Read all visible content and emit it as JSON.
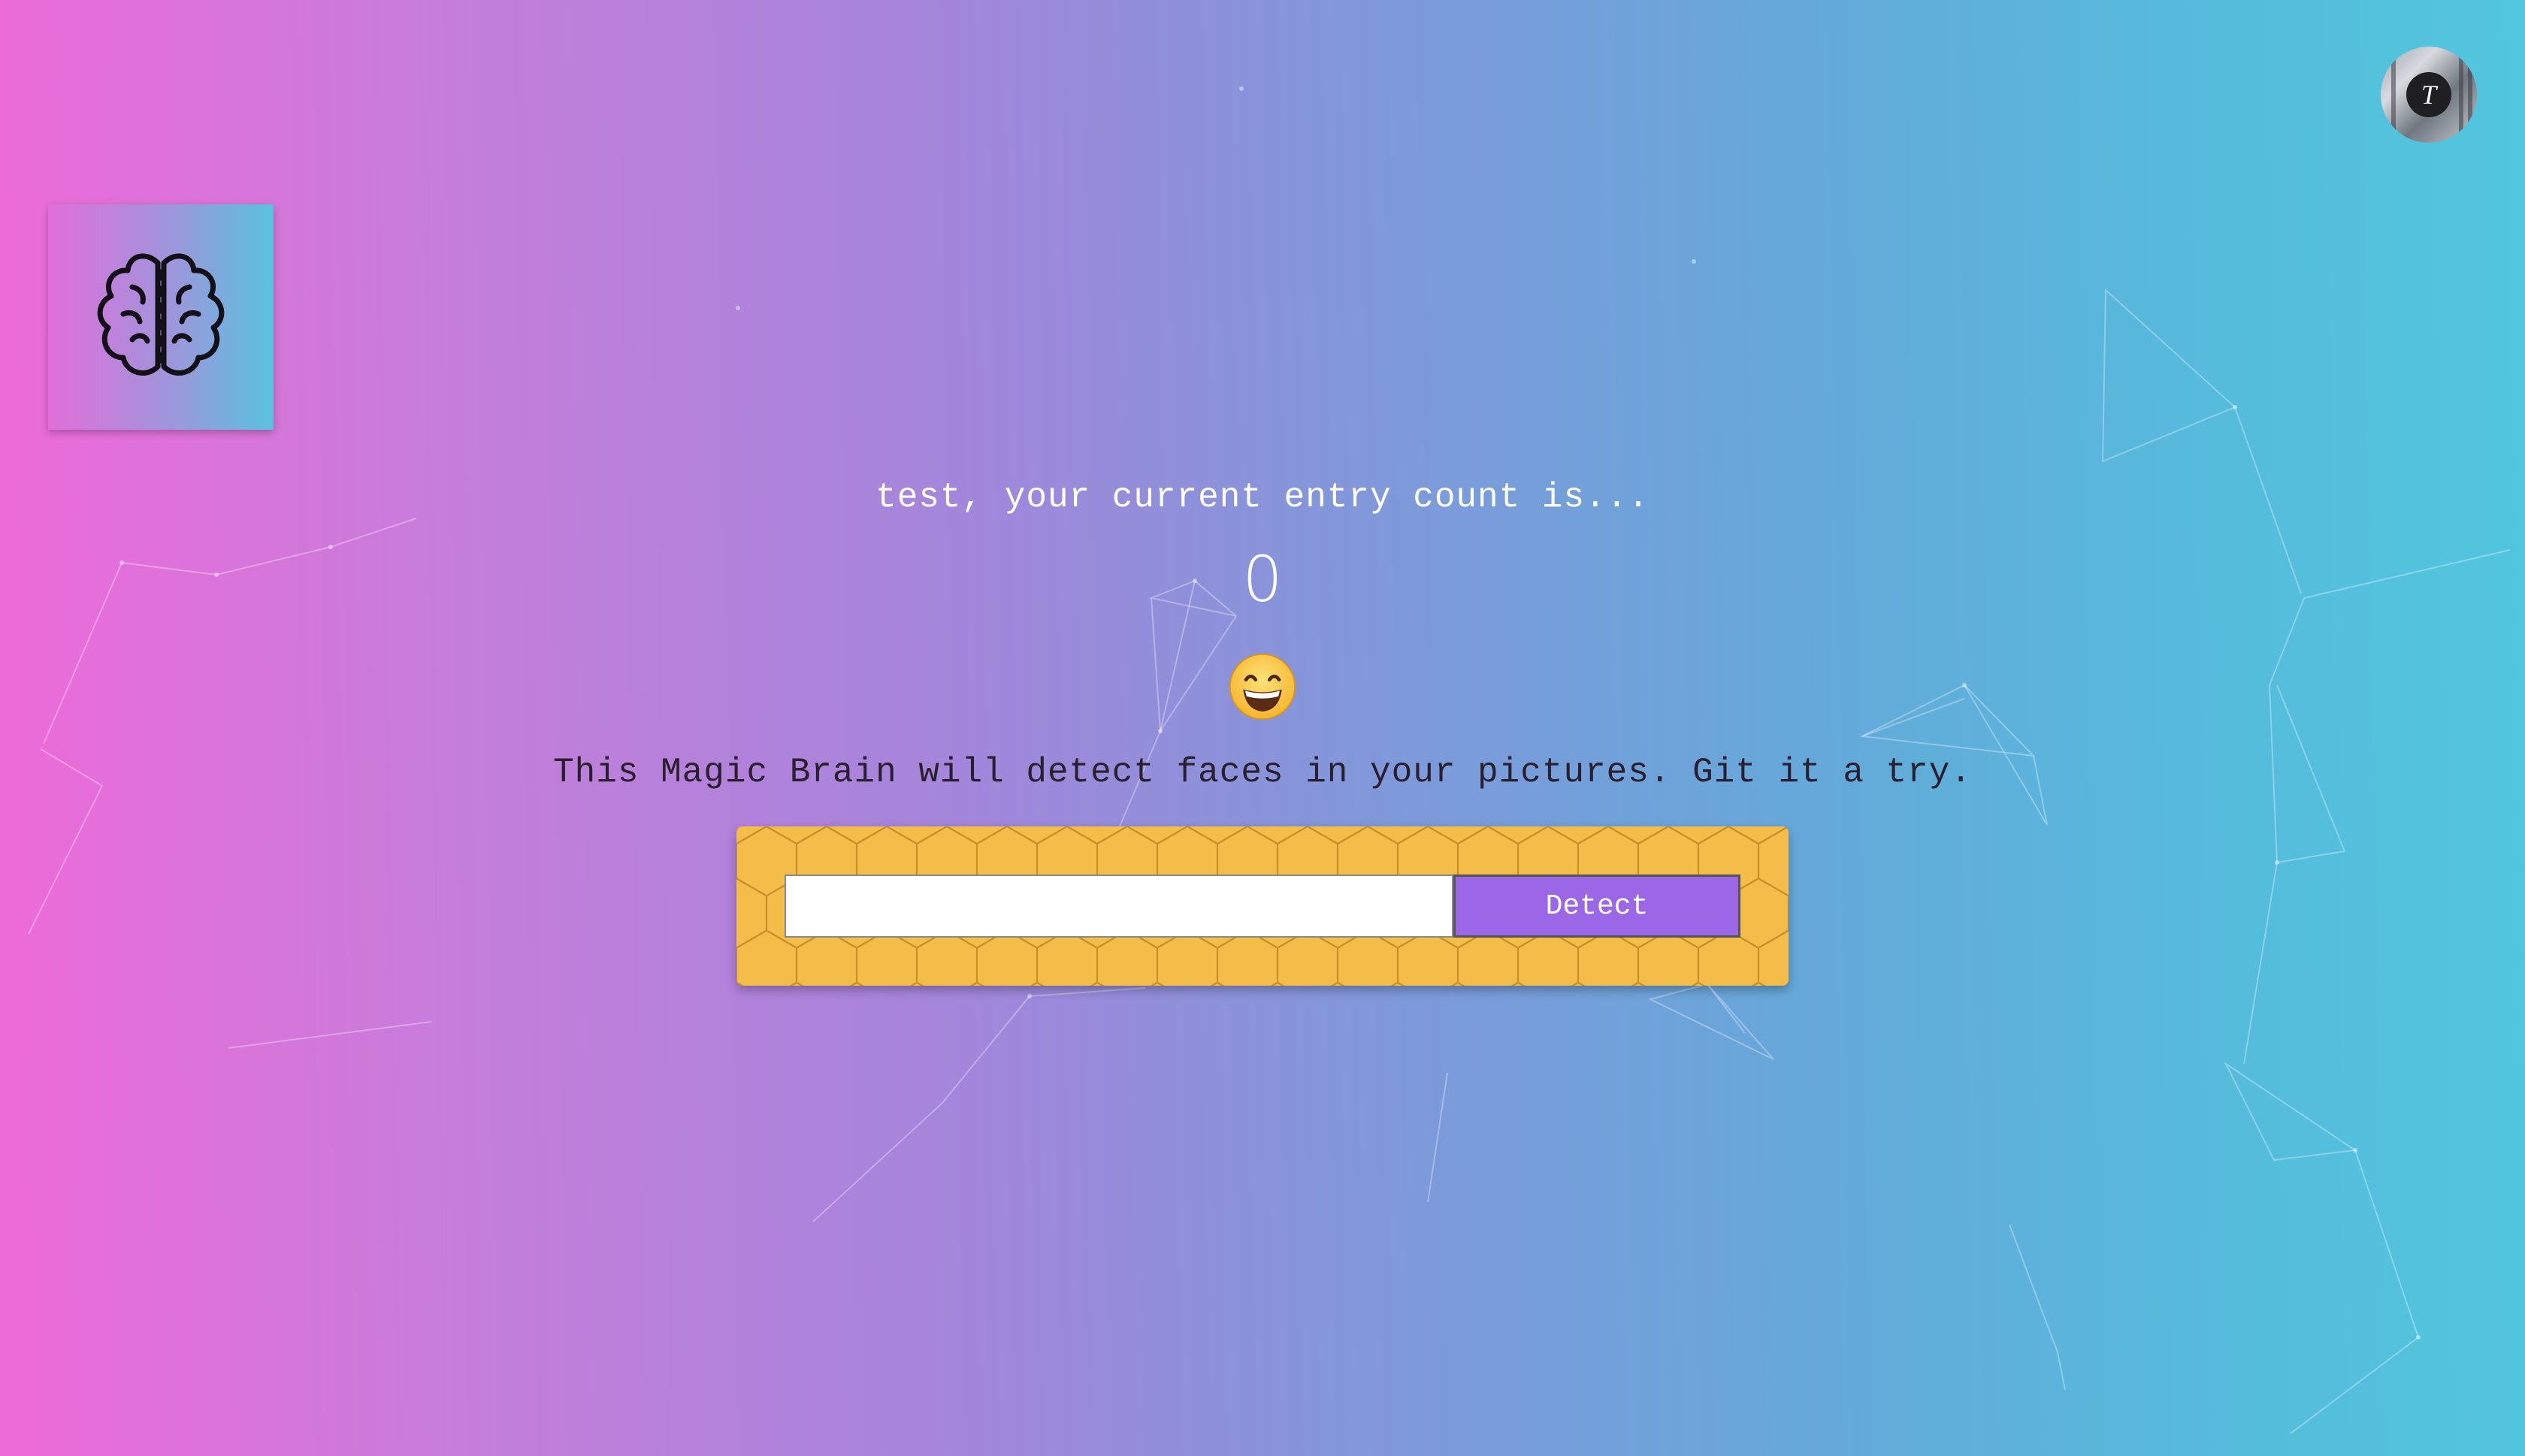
{
  "user": {
    "avatar_initial": "T"
  },
  "rank": {
    "greeting": "test, your current entry count is...",
    "count": "0"
  },
  "main": {
    "tagline": "This Magic Brain will detect faces in your pictures. Git it a try."
  },
  "form": {
    "input_value": "",
    "input_placeholder": "",
    "detect_label": "Detect"
  },
  "icons": {
    "logo": "brain-icon",
    "emoji": "grinning-face-emoji"
  },
  "colors": {
    "gradient_start": "#ee6ad9",
    "gradient_end": "#52c6de",
    "panel": "#f4bd4a",
    "button": "#9b67e6"
  }
}
